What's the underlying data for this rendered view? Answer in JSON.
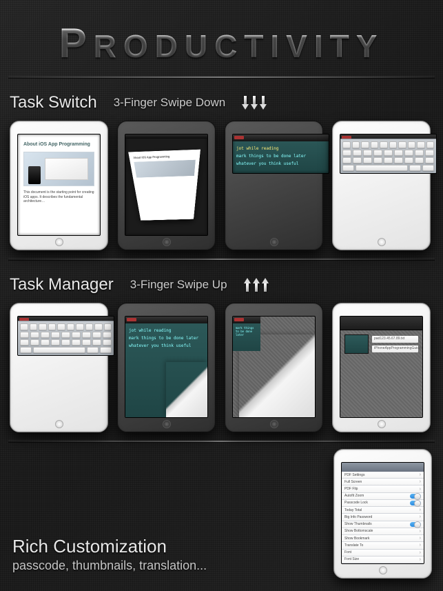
{
  "title": "Productivity",
  "section1": {
    "title": "Task Switch",
    "gesture": "3-Finger Swipe Down"
  },
  "section2": {
    "title": "Task Manager",
    "gesture": "3-Finger Swipe Up"
  },
  "doc": {
    "heading": "About iOS App Programming"
  },
  "notes": {
    "line1": "jot while reading",
    "line2": "mark things to be done later",
    "line3": "whatever you think useful"
  },
  "taskmgr": {
    "file": "iPhoneAppProgrammingGuide.pdf"
  },
  "settings": {
    "rows": [
      "PDF Settings",
      "Full Screen",
      "PDF Flip",
      "Autofit Zoom",
      "Passcode Lock",
      "Today Total",
      "Big Info Password",
      "Show Thumbnails",
      "Show Bottomscale",
      "Show Bookmark",
      "Translate To",
      "Font",
      "Font Size"
    ]
  },
  "rich": {
    "title": "Rich Customization",
    "subtitle": "passcode, thumbnails, translation..."
  },
  "colors": {
    "teal": "#2d5a5a"
  }
}
